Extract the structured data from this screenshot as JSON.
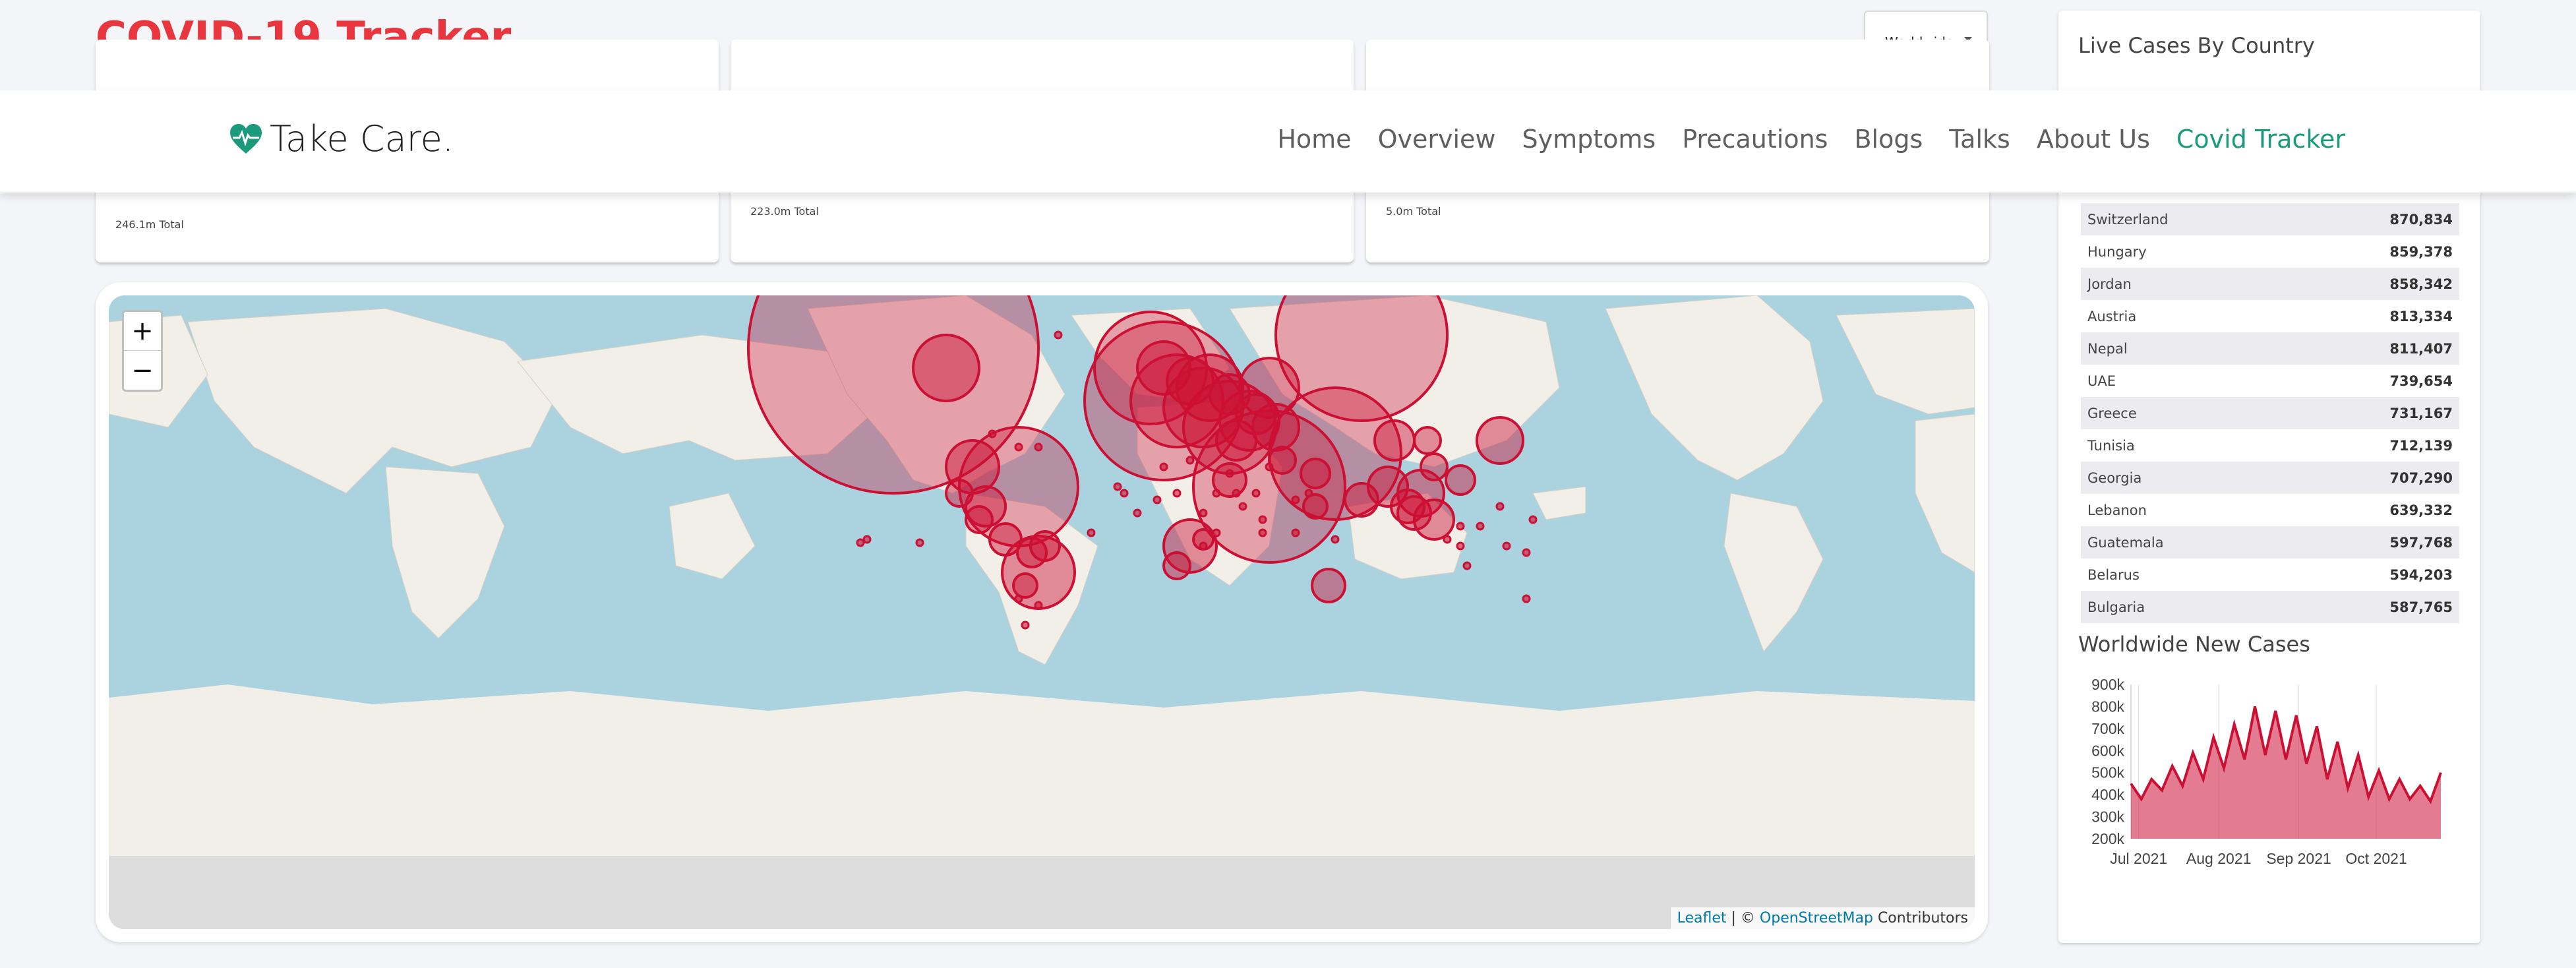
{
  "header": {
    "title": "COVID-19 Tracker"
  },
  "country_select": {
    "value": "Worldwide"
  },
  "cards": [
    {
      "total": "246.1m Total"
    },
    {
      "total": "223.0m Total"
    },
    {
      "total": "5.0m Total"
    }
  ],
  "navbar": {
    "brand": "Take Care.",
    "links": [
      "Home",
      "Overview",
      "Symptoms",
      "Precautions",
      "Blogs",
      "Talks",
      "About Us",
      "Covid Tracker"
    ],
    "active": "Covid Tracker"
  },
  "map": {
    "zoom_in": "+",
    "zoom_out": "−",
    "attribution_leaflet": "Leaflet",
    "attribution_sep": " | © ",
    "attribution_osm": "OpenStreetMap",
    "attribution_contrib": " Contributors",
    "circle_color": "#cc1034"
  },
  "side": {
    "title": "Live Cases By Country",
    "countries": [
      {
        "name": "Switzerland",
        "cases": "870,834"
      },
      {
        "name": "Hungary",
        "cases": "859,378"
      },
      {
        "name": "Jordan",
        "cases": "858,342"
      },
      {
        "name": "Austria",
        "cases": "813,334"
      },
      {
        "name": "Nepal",
        "cases": "811,407"
      },
      {
        "name": "UAE",
        "cases": "739,654"
      },
      {
        "name": "Greece",
        "cases": "731,167"
      },
      {
        "name": "Tunisia",
        "cases": "712,139"
      },
      {
        "name": "Georgia",
        "cases": "707,290"
      },
      {
        "name": "Lebanon",
        "cases": "639,332"
      },
      {
        "name": "Guatemala",
        "cases": "597,768"
      },
      {
        "name": "Belarus",
        "cases": "594,203"
      },
      {
        "name": "Bulgaria",
        "cases": "587,765"
      }
    ],
    "chart_title": "Worldwide New Cases"
  },
  "chart_data": {
    "type": "area",
    "x": [
      "2021-06-28",
      "2021-07-02",
      "2021-07-06",
      "2021-07-10",
      "2021-07-14",
      "2021-07-18",
      "2021-07-22",
      "2021-07-26",
      "2021-07-30",
      "2021-08-03",
      "2021-08-07",
      "2021-08-11",
      "2021-08-15",
      "2021-08-19",
      "2021-08-23",
      "2021-08-27",
      "2021-08-31",
      "2021-09-04",
      "2021-09-08",
      "2021-09-12",
      "2021-09-16",
      "2021-09-20",
      "2021-09-24",
      "2021-09-28",
      "2021-10-02",
      "2021-10-06",
      "2021-10-10",
      "2021-10-14",
      "2021-10-18",
      "2021-10-22",
      "2021-10-26"
    ],
    "y": [
      450000,
      380000,
      470000,
      420000,
      530000,
      440000,
      590000,
      470000,
      660000,
      520000,
      720000,
      560000,
      800000,
      580000,
      780000,
      560000,
      760000,
      540000,
      710000,
      470000,
      640000,
      430000,
      580000,
      390000,
      510000,
      380000,
      470000,
      380000,
      440000,
      370000,
      500000
    ],
    "ylim": [
      200000,
      900000
    ],
    "yticks": [
      "200k",
      "300k",
      "400k",
      "500k",
      "600k",
      "700k",
      "800k",
      "900k"
    ],
    "xticks": [
      "Jul 2021",
      "Aug 2021",
      "Sep 2021",
      "Oct 2021"
    ],
    "color": "#cc1034",
    "grid": true
  }
}
